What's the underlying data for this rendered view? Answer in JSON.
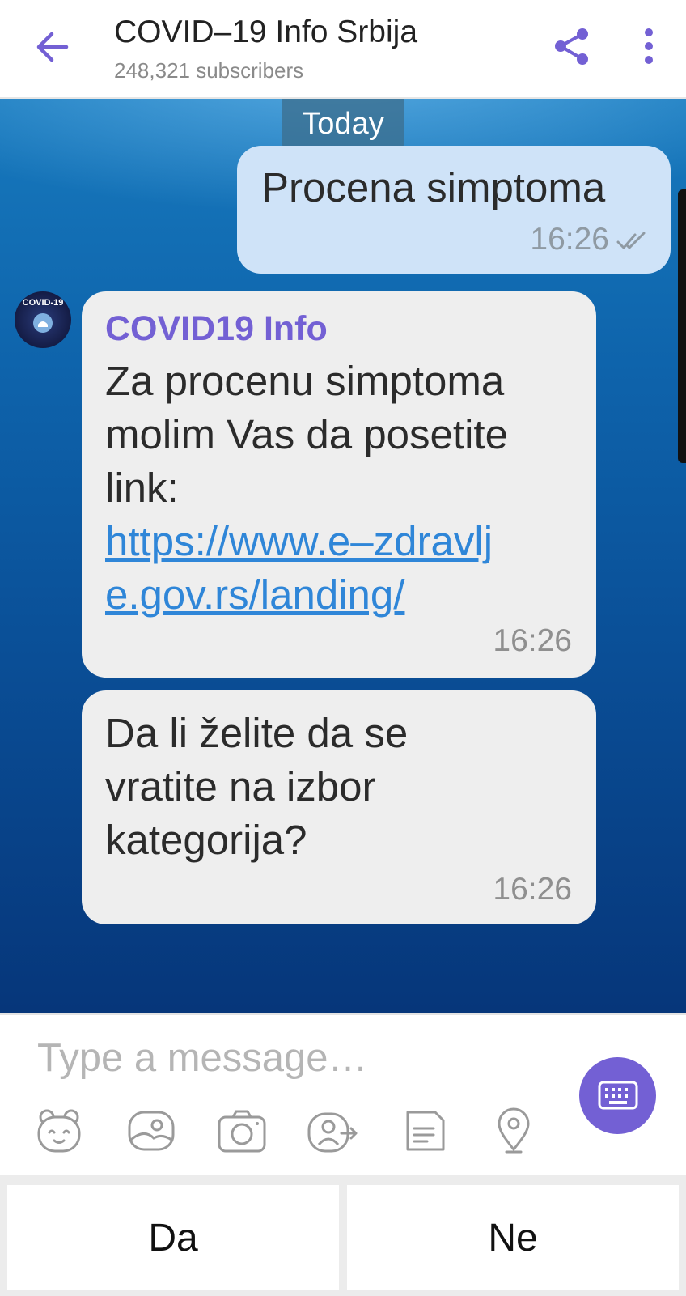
{
  "header": {
    "title": "COVID–19 Info Srbija",
    "subtitle": "248,321 subscribers",
    "back_icon": "arrow-left-icon",
    "share_icon": "share-icon",
    "more_icon": "more-vertical-icon"
  },
  "chat": {
    "date_separator": "Today",
    "outgoing": {
      "text": "Procena simptoma",
      "time": "16:26",
      "status_icon": "double-check-icon"
    },
    "incoming": [
      {
        "sender": "COVID19 Info",
        "lines": [
          "Za procenu simptoma",
          "molim Vas da posetite",
          "link:"
        ],
        "link_lines": [
          "https://www.e–zdravlj",
          "e.gov.rs/landing/"
        ],
        "time": "16:26"
      },
      {
        "lines": [
          "Da li želite da se",
          "vratite na izbor",
          "kategorija?"
        ],
        "time": "16:26"
      }
    ],
    "avatar": {
      "label": "COVID-19"
    }
  },
  "composer": {
    "placeholder": "Type a message…",
    "tools": [
      "sticker-icon",
      "gallery-icon",
      "camera-icon",
      "share-contact-icon",
      "file-icon",
      "location-icon"
    ],
    "keyboard_icon": "keyboard-icon"
  },
  "reply_buttons": [
    "Da",
    "Ne"
  ],
  "colors": {
    "accent": "#7360d4",
    "outgoing_bubble": "#cfe3f8",
    "incoming_bubble": "#eeeeee",
    "link": "#2f86d8"
  }
}
